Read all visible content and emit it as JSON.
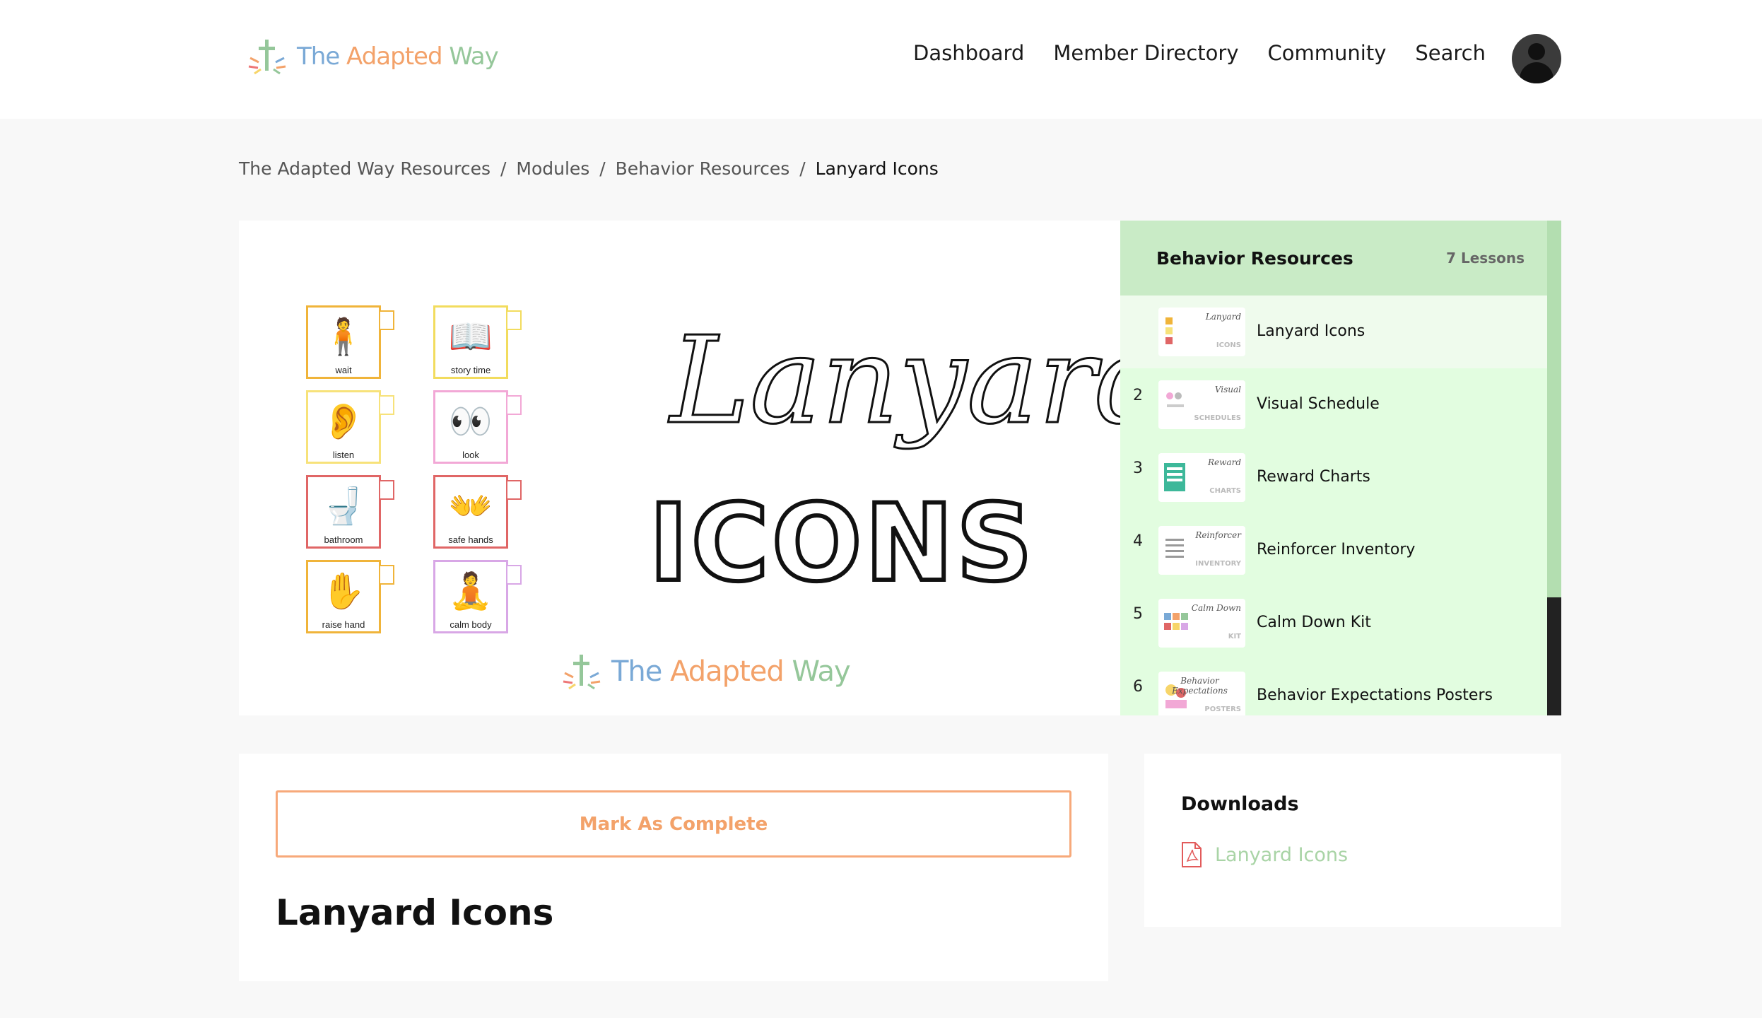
{
  "header": {
    "logo": {
      "part1": "The ",
      "part2": "Adapted ",
      "part3": "Way"
    },
    "nav": [
      "Dashboard",
      "Member Directory",
      "Community",
      "Search"
    ]
  },
  "breadcrumb": {
    "items": [
      "The Adapted Way Resources",
      "Modules",
      "Behavior Resources"
    ],
    "separator": "/",
    "current": "Lanyard Icons"
  },
  "hero": {
    "script_title": "Lanyard",
    "block_title": "ICONS",
    "cards": [
      {
        "label": "wait",
        "icon": "wait-icon",
        "color": "#f0b43a",
        "glyph": "🧍"
      },
      {
        "label": "story time",
        "icon": "story-time-icon",
        "color": "#f2dc5e",
        "glyph": "📖"
      },
      {
        "label": "listen",
        "icon": "listen-icon",
        "color": "#f7e27a",
        "glyph": "👂"
      },
      {
        "label": "look",
        "icon": "look-icon",
        "color": "#f2a8d6",
        "glyph": "👀"
      },
      {
        "label": "bathroom",
        "icon": "bathroom-icon",
        "color": "#e06666",
        "glyph": "🚽"
      },
      {
        "label": "safe hands",
        "icon": "safe-hands-icon",
        "color": "#e06666",
        "glyph": "👐"
      },
      {
        "label": "raise hand",
        "icon": "raise-hand-icon",
        "color": "#f0b43a",
        "glyph": "✋"
      },
      {
        "label": "calm body",
        "icon": "calm-body-icon",
        "color": "#d8a7e6",
        "glyph": "🧘"
      }
    ],
    "logo": {
      "part1": "The ",
      "part2": "Adapted ",
      "part3": "Way"
    }
  },
  "lessons": {
    "title": "Behavior Resources",
    "count": "7 Lessons",
    "items": [
      {
        "num": "",
        "title": "Lanyard Icons",
        "thumb_top": "Lanyard",
        "thumb_bottom": "ICONS",
        "active": true
      },
      {
        "num": "2",
        "title": "Visual Schedule",
        "thumb_top": "Visual",
        "thumb_bottom": "SCHEDULES",
        "active": false
      },
      {
        "num": "3",
        "title": "Reward Charts",
        "thumb_top": "Reward",
        "thumb_bottom": "CHARTS",
        "active": false
      },
      {
        "num": "4",
        "title": "Reinforcer Inventory",
        "thumb_top": "Reinforcer",
        "thumb_bottom": "INVENTORY",
        "active": false
      },
      {
        "num": "5",
        "title": "Calm Down Kit",
        "thumb_top": "Calm Down",
        "thumb_bottom": "KIT",
        "active": false
      },
      {
        "num": "6",
        "title": "Behavior Expectations Posters",
        "thumb_top": "Behavior Expectations",
        "thumb_bottom": "POSTERS",
        "active": false
      }
    ]
  },
  "content": {
    "complete_label": "Mark As Complete",
    "heading": "Lanyard Icons"
  },
  "downloads": {
    "title": "Downloads",
    "items": [
      {
        "label": "Lanyard Icons",
        "icon": "pdf-file-icon"
      }
    ]
  },
  "colors": {
    "accent_orange": "#f3a26a",
    "accent_green": "#a9d4a6",
    "sidebar_bg": "#e2fde0",
    "sidebar_head": "#c9ebc6"
  }
}
